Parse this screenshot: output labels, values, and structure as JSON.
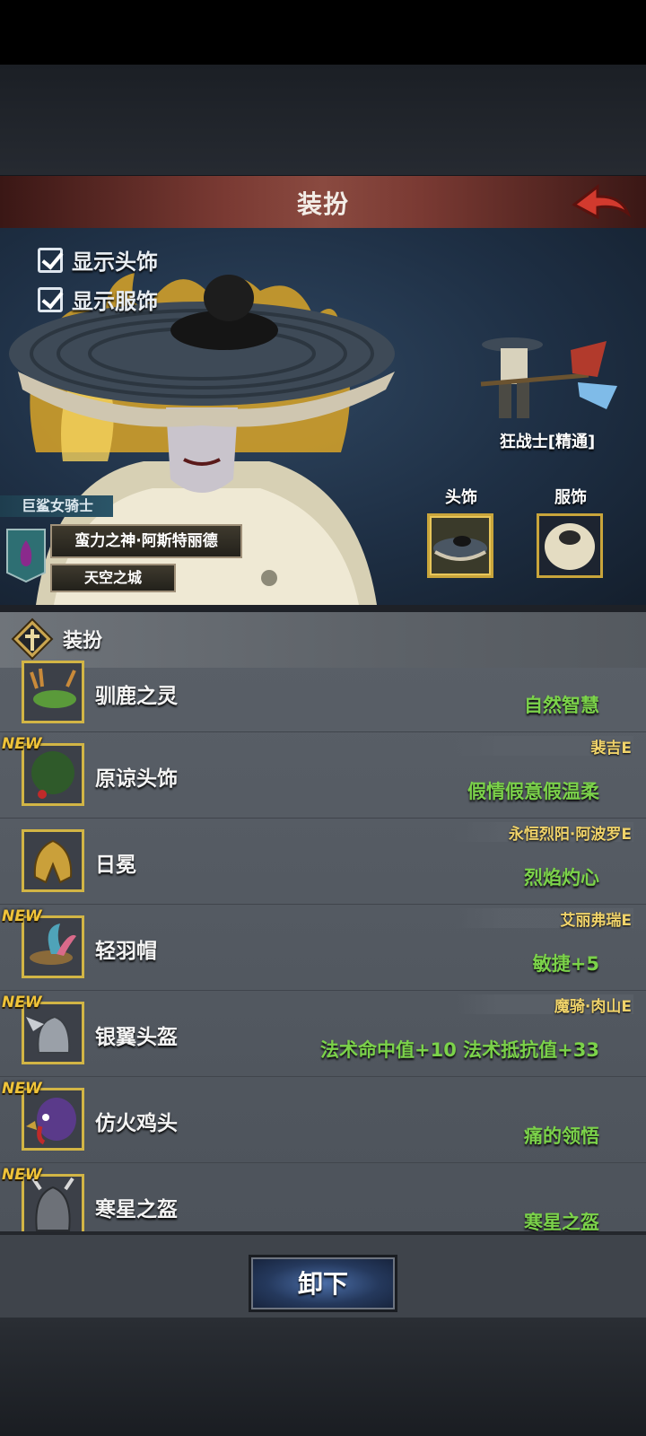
{
  "header": {
    "title": "装扮"
  },
  "options": {
    "show_headwear": "显示头饰",
    "show_outfit": "显示服饰"
  },
  "character": {
    "class_name": "狂战士[精通]",
    "slot_head_label": "头饰",
    "slot_outfit_label": "服饰",
    "title_banner": "巨鲨女骑士",
    "deity": "蛮力之神·阿斯特丽德",
    "origin": "天空之城"
  },
  "section": {
    "title": "装扮"
  },
  "items": [
    {
      "name": "驯鹿之灵",
      "source": "",
      "effect": "自然智慧",
      "is_new": false
    },
    {
      "name": "原谅头饰",
      "source": "裴吉E",
      "effect": "假情假意假温柔",
      "is_new": true,
      "new_label": "NEW"
    },
    {
      "name": "日冕",
      "source": "永恒烈阳·阿波罗E",
      "effect": "烈焰灼心",
      "is_new": false
    },
    {
      "name": "轻羽帽",
      "source": "艾丽弗瑞E",
      "effect": "敏捷+5",
      "is_new": true,
      "new_label": "NEW"
    },
    {
      "name": "银翼头盔",
      "source": "魔骑·肉山E",
      "effect": "法术命中值+10  法术抵抗值+33",
      "is_new": true,
      "new_label": "NEW"
    },
    {
      "name": "仿火鸡头",
      "source": "",
      "effect": "痛的领悟",
      "is_new": true,
      "new_label": "NEW"
    },
    {
      "name": "寒星之盔",
      "source": "",
      "effect": "寒星之盔",
      "is_new": true,
      "new_label": "NEW"
    }
  ],
  "footer": {
    "unequip_label": "卸下"
  },
  "icons": {
    "back": "back-arrow-icon",
    "check": "checkbox-checked-icon",
    "section": "cross-emblem-icon"
  },
  "colors": {
    "effect_green": "#7bd24a",
    "source_gold": "#f0d36a",
    "new_gold": "#f0c43a",
    "frame_gold": "#d2b545"
  }
}
